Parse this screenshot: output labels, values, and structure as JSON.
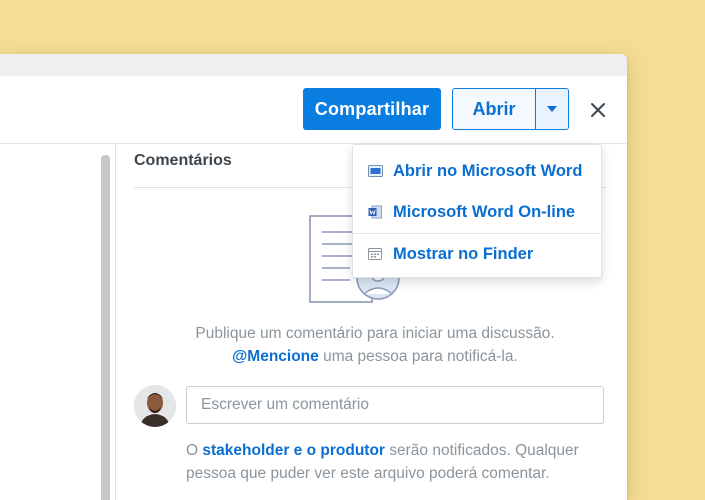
{
  "toolbar": {
    "share_label": "Compartilhar",
    "open_label": "Abrir",
    "caret_icon": "caret-down-icon",
    "close_icon": "close-icon"
  },
  "open_menu": {
    "items": [
      {
        "label": "Abrir no Microsoft Word",
        "icon": "desktop-app-icon"
      },
      {
        "label": "Microsoft Word On-line",
        "icon": "word-icon"
      },
      {
        "label": "Mostrar no Finder",
        "icon": "finder-icon"
      }
    ]
  },
  "comments": {
    "title": "Comentários",
    "empty_line1": "Publique um comentário para iniciar uma discussão.",
    "mention_link": "@Mencione",
    "empty_line2_rest": " uma pessoa para notificá-la.",
    "input_placeholder": "Escrever um comentário",
    "notice_prefix": "O ",
    "notice_link": "stakeholder e o produtor",
    "notice_rest": " serão notificados. Qualquer pessoa que puder ver este arquivo poderá comentar."
  },
  "colors": {
    "accent": "#0a7de0",
    "background": "#f6dd96",
    "muted_text": "#8b959c"
  }
}
